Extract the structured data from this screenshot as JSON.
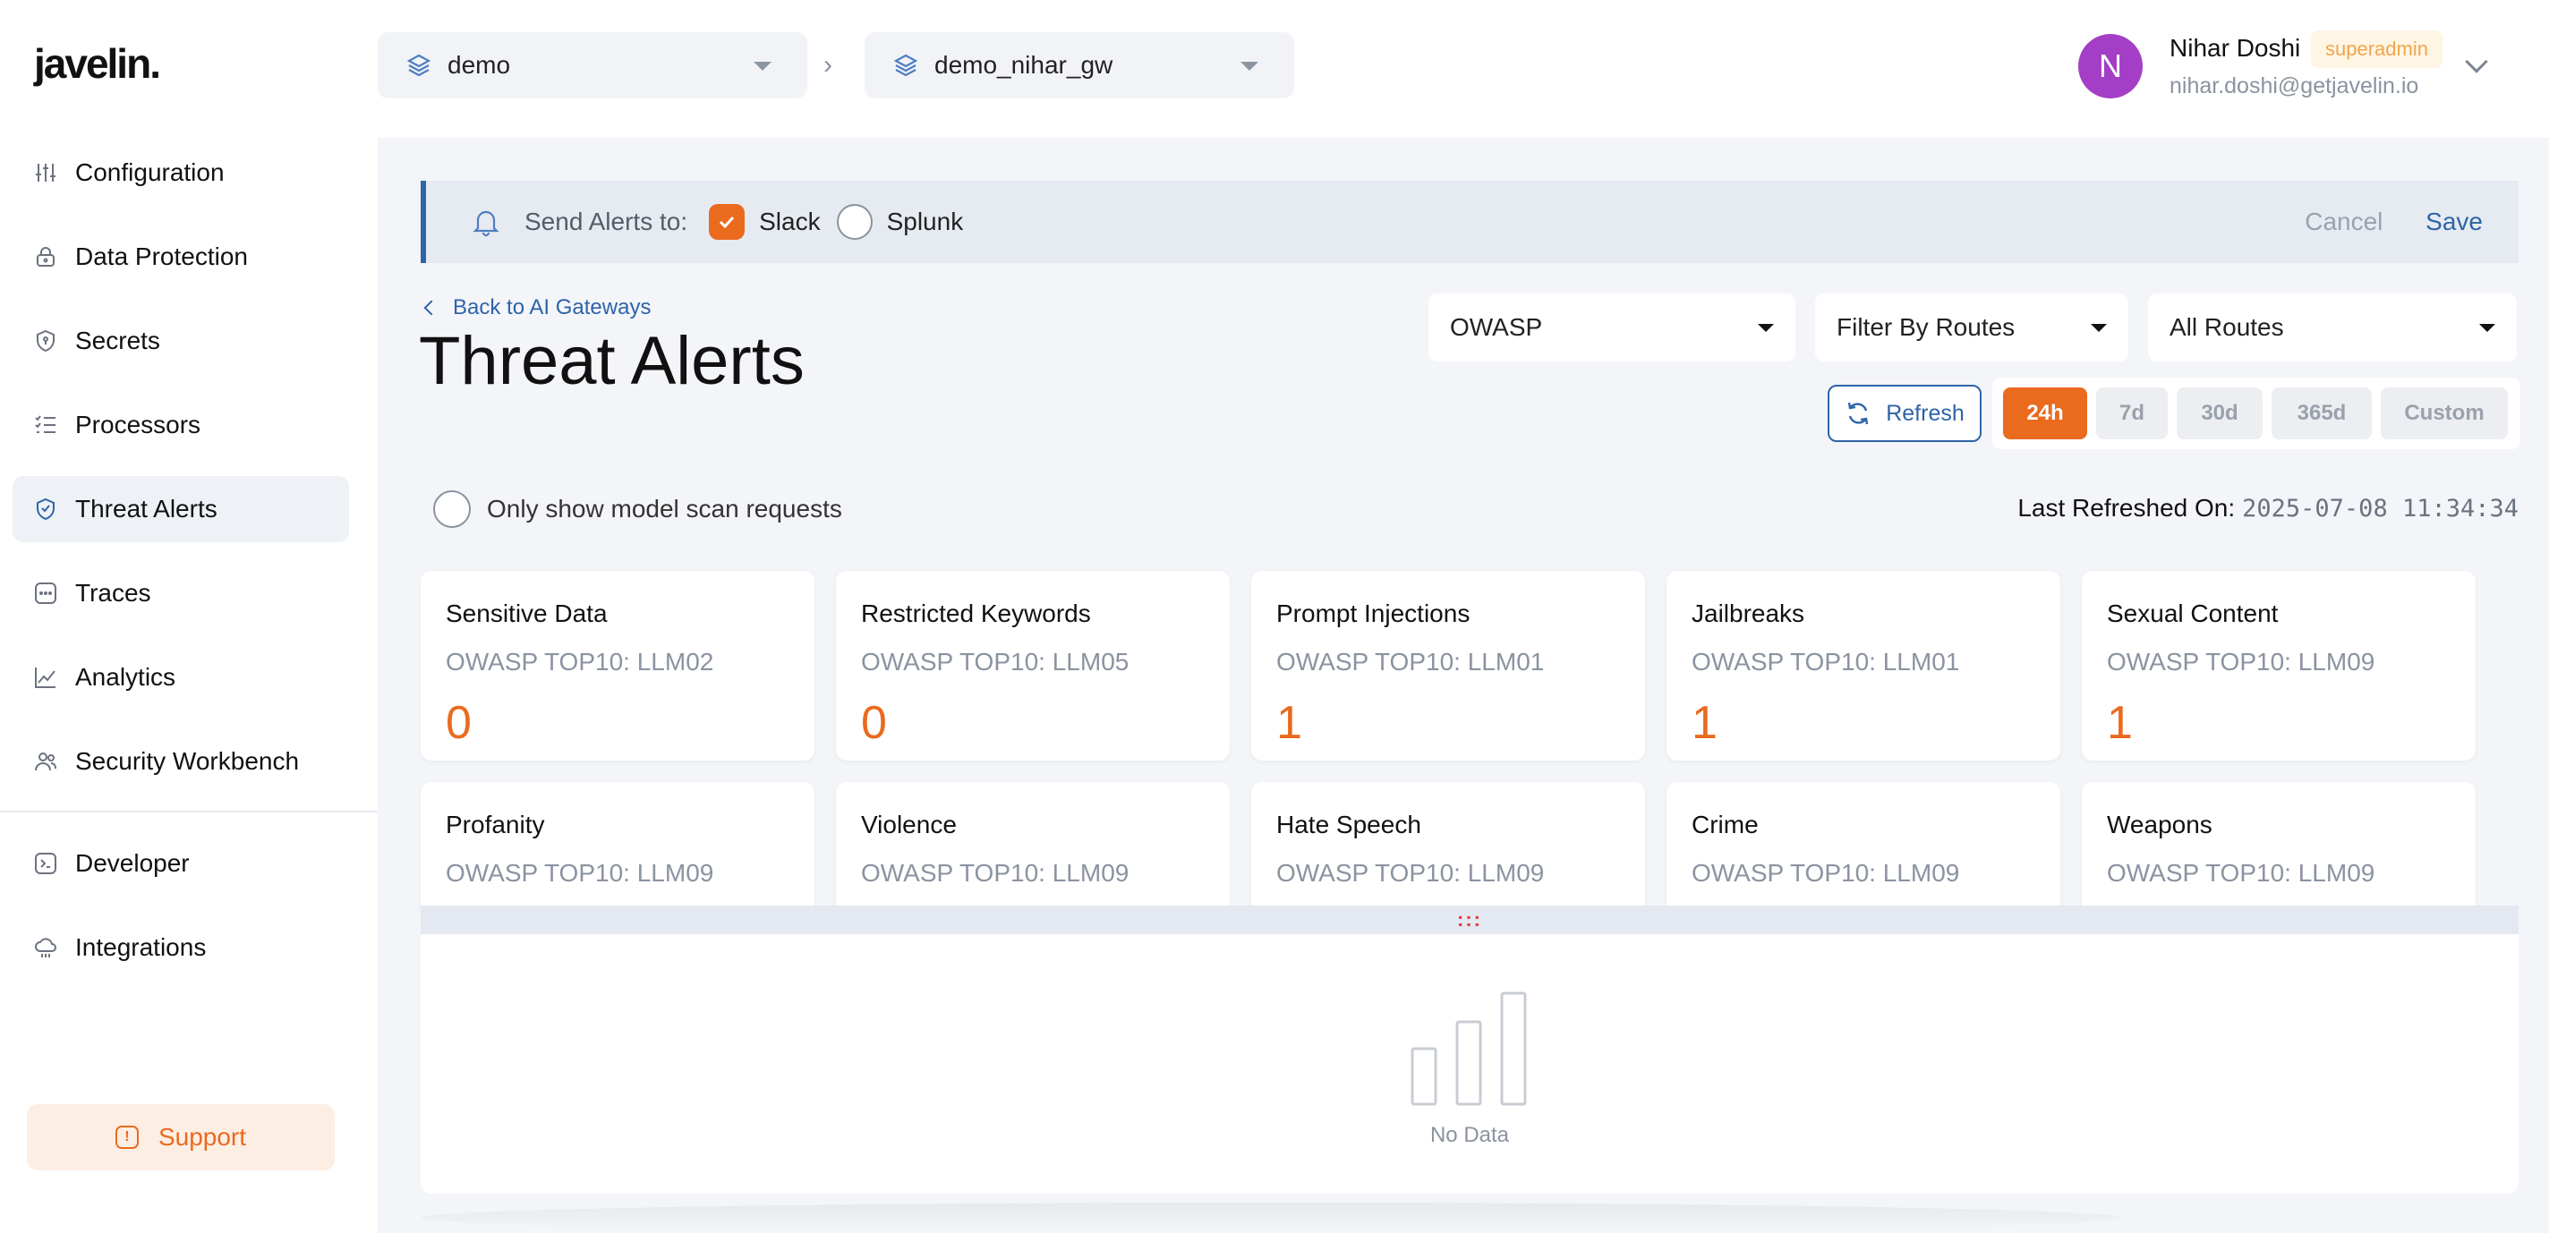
{
  "app": {
    "logo": "javelin."
  },
  "sidebar": {
    "items": [
      {
        "label": "Configuration",
        "icon": "sliders-icon"
      },
      {
        "label": "Data Protection",
        "icon": "lock-icon"
      },
      {
        "label": "Secrets",
        "icon": "shield-lock-icon"
      },
      {
        "label": "Processors",
        "icon": "list-check-icon"
      },
      {
        "label": "Threat Alerts",
        "icon": "shield-check-icon",
        "active": true
      },
      {
        "label": "Traces",
        "icon": "dots-square-icon"
      },
      {
        "label": "Analytics",
        "icon": "line-chart-icon"
      },
      {
        "label": "Security Workbench",
        "icon": "users-icon"
      }
    ],
    "items2": [
      {
        "label": "Developer",
        "icon": "terminal-icon"
      },
      {
        "label": "Integrations",
        "icon": "cloud-icon"
      }
    ],
    "support_label": "Support"
  },
  "topbar": {
    "project": "demo",
    "gateway": "demo_nihar_gw",
    "user": {
      "initial": "N",
      "name": "Nihar Doshi",
      "role": "superadmin",
      "email": "nihar.doshi@getjavelin.io"
    }
  },
  "alerts_banner": {
    "label": "Send Alerts to:",
    "options": [
      {
        "label": "Slack",
        "checked": true
      },
      {
        "label": "Splunk",
        "checked": false
      }
    ],
    "cancel": "Cancel",
    "save": "Save"
  },
  "header": {
    "back_link": "Back to AI Gateways",
    "title": "Threat Alerts",
    "filters": {
      "framework": "OWASP",
      "filter_by": "Filter By Routes",
      "routes": "All Routes"
    },
    "refresh": "Refresh",
    "ranges": [
      "24h",
      "7d",
      "30d",
      "365d",
      "Custom"
    ],
    "active_range": "24h"
  },
  "scan_toggle": "Only show model scan requests",
  "last_refreshed": {
    "label": "Last Refreshed On:",
    "value": "2025-07-08 11:34:34"
  },
  "cards_row1": [
    {
      "title": "Sensitive Data",
      "sub": "OWASP TOP10: LLM02",
      "value": "0"
    },
    {
      "title": "Restricted Keywords",
      "sub": "OWASP TOP10: LLM05",
      "value": "0"
    },
    {
      "title": "Prompt Injections",
      "sub": "OWASP TOP10: LLM01",
      "value": "1"
    },
    {
      "title": "Jailbreaks",
      "sub": "OWASP TOP10: LLM01",
      "value": "1"
    },
    {
      "title": "Sexual Content",
      "sub": "OWASP TOP10: LLM09",
      "value": "1"
    }
  ],
  "cards_row2": [
    {
      "title": "Profanity",
      "sub": "OWASP TOP10: LLM09"
    },
    {
      "title": "Violence",
      "sub": "OWASP TOP10: LLM09"
    },
    {
      "title": "Hate Speech",
      "sub": "OWASP TOP10: LLM09"
    },
    {
      "title": "Crime",
      "sub": "OWASP TOP10: LLM09"
    },
    {
      "title": "Weapons",
      "sub": "OWASP TOP10: LLM09"
    }
  ],
  "resize_handle": ":::",
  "empty_state": {
    "label": "No Data",
    "icon": "bar-chart-icon"
  },
  "colors": {
    "accent": "#ea6a1e",
    "primary": "#2e64a8",
    "avatar": "#a43ec6"
  }
}
